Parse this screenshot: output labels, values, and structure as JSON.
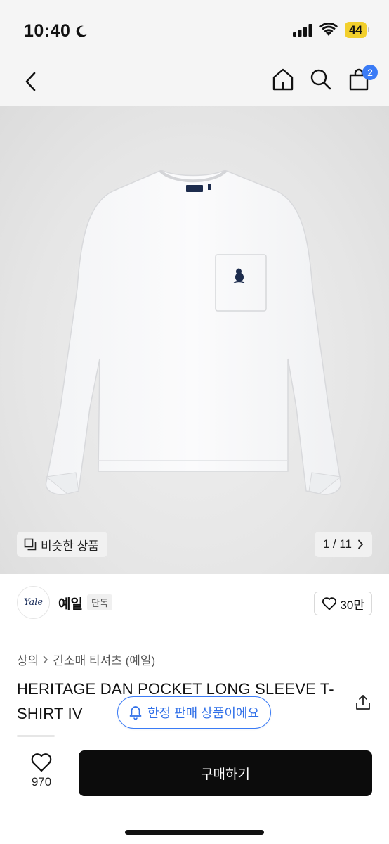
{
  "status": {
    "time": "10:40",
    "battery": "44"
  },
  "nav": {
    "cart_count": "2"
  },
  "hero": {
    "similar_label": "비슷한 상품",
    "pager": "1 / 11",
    "logo_text": "Yale"
  },
  "brand": {
    "logo_text": "Yale",
    "name": "예일",
    "tag": "단독",
    "likes": "30만"
  },
  "breadcrumb": {
    "category": "상의",
    "subcategory": "긴소매 티셔츠 (예일)"
  },
  "product": {
    "title": "HERITAGE DAN POCKET LONG SLEEVE T-SHIRT IV",
    "limited_label": "한정 판매 상품이에요"
  },
  "bottom": {
    "like_count": "970",
    "buy_label": "구매하기"
  },
  "colors": {
    "accent": "#3a7bf6",
    "buy_button": "#0c0c0c",
    "battery": "#f2cf2c"
  },
  "icons": [
    "back-icon",
    "home-icon",
    "search-icon",
    "cart-icon",
    "similar-icon",
    "chevron-right-icon",
    "heart-icon",
    "share-icon",
    "bell-icon",
    "moon-icon",
    "signal-icon",
    "wifi-icon"
  ]
}
